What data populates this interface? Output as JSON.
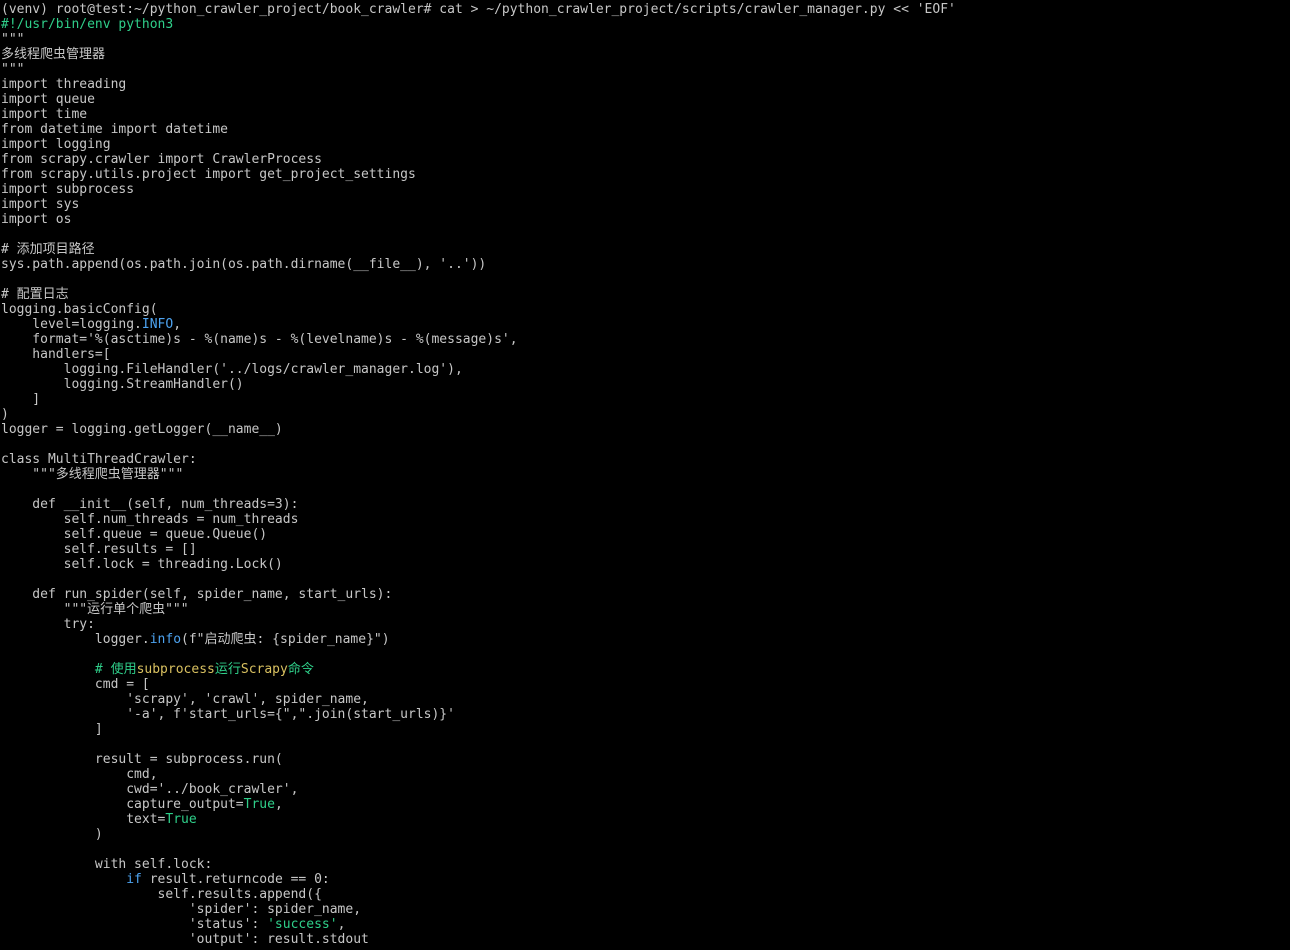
{
  "terminal": {
    "colors": {
      "background": "#000000",
      "text": "#c7c7c7",
      "green": "#2fcf8a",
      "blue": "#4da3f0",
      "yellow": "#d8c060"
    },
    "lines": [
      [
        {
          "t": "(venv) root@test:~/python_crawler_project/book_crawler# cat > ~/python_crawler_project/scripts/crawler_manager.py << 'EOF'",
          "c": "text"
        }
      ],
      [
        {
          "t": "#!/usr/bin/env python3",
          "c": "green"
        }
      ],
      [
        {
          "t": "\"\"\"",
          "c": "text"
        }
      ],
      [
        {
          "t": "多线程爬虫管理器",
          "c": "text"
        }
      ],
      [
        {
          "t": "\"\"\"",
          "c": "text"
        }
      ],
      [
        {
          "t": "import threading",
          "c": "text"
        }
      ],
      [
        {
          "t": "import queue",
          "c": "text"
        }
      ],
      [
        {
          "t": "import time",
          "c": "text"
        }
      ],
      [
        {
          "t": "from datetime import datetime",
          "c": "text"
        }
      ],
      [
        {
          "t": "import logging",
          "c": "text"
        }
      ],
      [
        {
          "t": "from scrapy.crawler import CrawlerProcess",
          "c": "text"
        }
      ],
      [
        {
          "t": "from scrapy.utils.project import get_project_settings",
          "c": "text"
        }
      ],
      [
        {
          "t": "import subprocess",
          "c": "text"
        }
      ],
      [
        {
          "t": "import sys",
          "c": "text"
        }
      ],
      [
        {
          "t": "import os",
          "c": "text"
        }
      ],
      [
        {
          "t": "",
          "c": "text"
        }
      ],
      [
        {
          "t": "# 添加项目路径",
          "c": "text"
        }
      ],
      [
        {
          "t": "sys.path.append(os.path.join(os.path.dirname(__file__), '..'))",
          "c": "text"
        }
      ],
      [
        {
          "t": "",
          "c": "text"
        }
      ],
      [
        {
          "t": "# 配置日志",
          "c": "text"
        }
      ],
      [
        {
          "t": "logging.basicConfig(",
          "c": "text"
        }
      ],
      [
        {
          "t": "    level=logging.",
          "c": "text"
        },
        {
          "t": "INFO",
          "c": "blue"
        },
        {
          "t": ",",
          "c": "text"
        }
      ],
      [
        {
          "t": "    format='%(asctime)s - %(name)s - %(levelname)s - %(message)s',",
          "c": "text"
        }
      ],
      [
        {
          "t": "    handlers=[",
          "c": "text"
        }
      ],
      [
        {
          "t": "        logging.FileHandler('../logs/crawler_manager.log'),",
          "c": "text"
        }
      ],
      [
        {
          "t": "        logging.StreamHandler()",
          "c": "text"
        }
      ],
      [
        {
          "t": "    ]",
          "c": "text"
        }
      ],
      [
        {
          "t": ")",
          "c": "text"
        }
      ],
      [
        {
          "t": "logger = logging.getLogger(__name__)",
          "c": "text"
        }
      ],
      [
        {
          "t": "",
          "c": "text"
        }
      ],
      [
        {
          "t": "class MultiThreadCrawler:",
          "c": "text"
        }
      ],
      [
        {
          "t": "    \"\"\"多线程爬虫管理器\"\"\"",
          "c": "text"
        }
      ],
      [
        {
          "t": "",
          "c": "text"
        }
      ],
      [
        {
          "t": "    def __init__(self, num_threads=3):",
          "c": "text"
        }
      ],
      [
        {
          "t": "        self.num_threads = num_threads",
          "c": "text"
        }
      ],
      [
        {
          "t": "        self.queue = queue.Queue()",
          "c": "text"
        }
      ],
      [
        {
          "t": "        self.results = []",
          "c": "text"
        }
      ],
      [
        {
          "t": "        self.lock = threading.Lock()",
          "c": "text"
        }
      ],
      [
        {
          "t": "",
          "c": "text"
        }
      ],
      [
        {
          "t": "    def run_spider(self, spider_name, start_urls):",
          "c": "text"
        }
      ],
      [
        {
          "t": "        \"\"\"运行单个爬虫\"\"\"",
          "c": "text"
        }
      ],
      [
        {
          "t": "        try:",
          "c": "text"
        }
      ],
      [
        {
          "t": "            logger.",
          "c": "text"
        },
        {
          "t": "info",
          "c": "blue"
        },
        {
          "t": "(f\"启动爬虫: {spider_name}\")",
          "c": "text"
        }
      ],
      [
        {
          "t": "",
          "c": "text"
        }
      ],
      [
        {
          "t": "            # 使用",
          "c": "green"
        },
        {
          "t": "subprocess",
          "c": "yellow"
        },
        {
          "t": "运行",
          "c": "green"
        },
        {
          "t": "Scrapy",
          "c": "yellow"
        },
        {
          "t": "命令",
          "c": "green"
        }
      ],
      [
        {
          "t": "            cmd = [",
          "c": "text"
        }
      ],
      [
        {
          "t": "                'scrapy', 'crawl', spider_name,",
          "c": "text"
        }
      ],
      [
        {
          "t": "                '-a', f'start_urls={\",\".join(start_urls)}'",
          "c": "text"
        }
      ],
      [
        {
          "t": "            ]",
          "c": "text"
        }
      ],
      [
        {
          "t": "",
          "c": "text"
        }
      ],
      [
        {
          "t": "            result = subprocess.run(",
          "c": "text"
        }
      ],
      [
        {
          "t": "                cmd,",
          "c": "text"
        }
      ],
      [
        {
          "t": "                cwd='../book_crawler',",
          "c": "text"
        }
      ],
      [
        {
          "t": "                capture_output=",
          "c": "text"
        },
        {
          "t": "True",
          "c": "green"
        },
        {
          "t": ",",
          "c": "text"
        }
      ],
      [
        {
          "t": "                text=",
          "c": "text"
        },
        {
          "t": "True",
          "c": "green"
        }
      ],
      [
        {
          "t": "            )",
          "c": "text"
        }
      ],
      [
        {
          "t": "",
          "c": "text"
        }
      ],
      [
        {
          "t": "            with self.lock:",
          "c": "text"
        }
      ],
      [
        {
          "t": "                ",
          "c": "text"
        },
        {
          "t": "if",
          "c": "blue"
        },
        {
          "t": " result.returncode == 0:",
          "c": "text"
        }
      ],
      [
        {
          "t": "                    self.results.append({",
          "c": "text"
        }
      ],
      [
        {
          "t": "                        'spider': spider_name,",
          "c": "text"
        }
      ],
      [
        {
          "t": "                        'status': ",
          "c": "text"
        },
        {
          "t": "'success'",
          "c": "green"
        },
        {
          "t": ",",
          "c": "text"
        }
      ],
      [
        {
          "t": "                        'output': result.stdout",
          "c": "text"
        }
      ]
    ]
  }
}
